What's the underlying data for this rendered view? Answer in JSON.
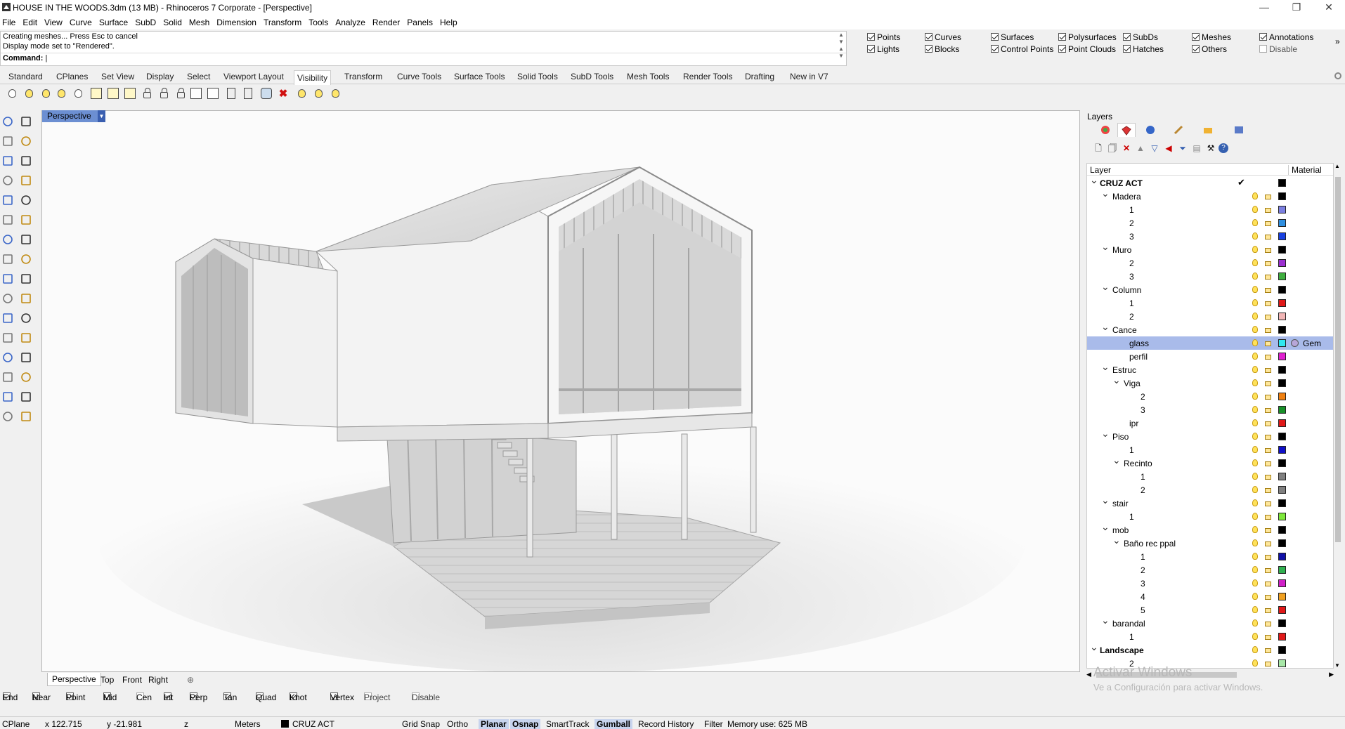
{
  "window": {
    "title": "HOUSE IN THE WOODS.3dm (13 MB) - Rhinoceros 7 Corporate - [Perspective]",
    "minimize": "—",
    "maximize": "❐",
    "close": "✕"
  },
  "menu": [
    "File",
    "Edit",
    "View",
    "Curve",
    "Surface",
    "SubD",
    "Solid",
    "Mesh",
    "Dimension",
    "Transform",
    "Tools",
    "Analyze",
    "Render",
    "Panels",
    "Help"
  ],
  "command": {
    "history1": "Creating meshes... Press Esc to cancel",
    "history2": "Display mode set to \"Rendered\".",
    "prompt": "Command:"
  },
  "selection_filters": {
    "row1": [
      {
        "label": "Points",
        "on": true
      },
      {
        "label": "Curves",
        "on": true
      },
      {
        "label": "Surfaces",
        "on": true
      },
      {
        "label": "Polysurfaces",
        "on": true
      },
      {
        "label": "SubDs",
        "on": true
      },
      {
        "label": "Meshes",
        "on": true
      },
      {
        "label": "Annotations",
        "on": true
      }
    ],
    "row2": [
      {
        "label": "Lights",
        "on": true
      },
      {
        "label": "Blocks",
        "on": true
      },
      {
        "label": "Control Points",
        "on": true
      },
      {
        "label": "Point Clouds",
        "on": true
      },
      {
        "label": "Hatches",
        "on": true
      },
      {
        "label": "Others",
        "on": true
      },
      {
        "label": "Disable",
        "on": false
      }
    ],
    "more": "»"
  },
  "toolbar_tabs": [
    "Standard",
    "CPlanes",
    "Set View",
    "Display",
    "Select",
    "Viewport Layout",
    "Visibility",
    "Transform",
    "Curve Tools",
    "Surface Tools",
    "Solid Tools",
    "SubD Tools",
    "Mesh Tools",
    "Render Tools",
    "Drafting",
    "New in V7"
  ],
  "active_toolbar_tab": "Visibility",
  "viewport": {
    "title": "Perspective",
    "tabs": [
      "Perspective",
      "Top",
      "Front",
      "Right"
    ],
    "add_tab": "⊕"
  },
  "osnaps": [
    {
      "label": "End",
      "on": true
    },
    {
      "label": "Near",
      "on": true
    },
    {
      "label": "Point",
      "on": true
    },
    {
      "label": "Mid",
      "on": true
    },
    {
      "label": "Cen",
      "on": false
    },
    {
      "label": "Int",
      "on": true
    },
    {
      "label": "Perp",
      "on": true
    },
    {
      "label": "Tan",
      "on": true
    },
    {
      "label": "Quad",
      "on": true
    },
    {
      "label": "Knot",
      "on": true
    },
    {
      "label": "Vertex",
      "on": true
    },
    {
      "label": "Project",
      "on": false
    },
    {
      "label": "Disable",
      "on": false
    }
  ],
  "status": {
    "cplane": "CPlane",
    "x": "x 122.715",
    "y": "y -21.981",
    "z": "z",
    "units": "Meters",
    "layer": "CRUZ ACT",
    "grid_snap": "Grid Snap",
    "ortho": "Ortho",
    "planar": "Planar",
    "osnap": "Osnap",
    "smarttrack": "SmartTrack",
    "gumball": "Gumball",
    "record_history": "Record History",
    "filter": "Filter",
    "memory": "Memory use: 625 MB"
  },
  "layers_panel": {
    "title": "Layers",
    "col_layer": "Layer",
    "col_material": "Material",
    "rows": [
      {
        "name": "CRUZ ACT",
        "level": 0,
        "expand": true,
        "current": true,
        "color": "#000000"
      },
      {
        "name": "Madera",
        "level": 1,
        "expand": true,
        "color": "#000000"
      },
      {
        "name": "1",
        "level": 2,
        "color": "#7b7fe0"
      },
      {
        "name": "2",
        "level": 2,
        "color": "#2f8fe0"
      },
      {
        "name": "3",
        "level": 2,
        "color": "#1840e0"
      },
      {
        "name": "Muro",
        "level": 1,
        "expand": true,
        "color": "#000000"
      },
      {
        "name": "2",
        "level": 2,
        "color": "#9b2fd0"
      },
      {
        "name": "3",
        "level": 2,
        "color": "#3fae3f"
      },
      {
        "name": "Column",
        "level": 1,
        "expand": true,
        "color": "#000000"
      },
      {
        "name": "1",
        "level": 2,
        "color": "#e01818"
      },
      {
        "name": "2",
        "level": 2,
        "color": "#f2b6b6"
      },
      {
        "name": "Cance",
        "level": 1,
        "expand": true,
        "color": "#000000"
      },
      {
        "name": "glass",
        "level": 2,
        "color": "#30e8f0",
        "selected": true,
        "material": "Gem"
      },
      {
        "name": "perfil",
        "level": 2,
        "color": "#e020d0"
      },
      {
        "name": "Estruc",
        "level": 1,
        "expand": true,
        "color": "#000000"
      },
      {
        "name": "Viga",
        "level": 2,
        "expand": true,
        "color": "#000000"
      },
      {
        "name": "2",
        "level": 3,
        "color": "#f08010"
      },
      {
        "name": "3",
        "level": 3,
        "color": "#189028"
      },
      {
        "name": "ipr",
        "level": 2,
        "color": "#e01818"
      },
      {
        "name": "Piso",
        "level": 1,
        "expand": true,
        "color": "#000000"
      },
      {
        "name": "1",
        "level": 2,
        "color": "#1010c8"
      },
      {
        "name": "Recinto",
        "level": 2,
        "expand": true,
        "color": "#000000"
      },
      {
        "name": "1",
        "level": 3,
        "color": "#808080"
      },
      {
        "name": "2",
        "level": 3,
        "color": "#808080"
      },
      {
        "name": "stair",
        "level": 1,
        "expand": true,
        "color": "#000000"
      },
      {
        "name": "1",
        "level": 2,
        "color": "#7ee83a"
      },
      {
        "name": "mob",
        "level": 1,
        "expand": true,
        "color": "#000000"
      },
      {
        "name": "Baño rec ppal",
        "level": 2,
        "expand": true,
        "color": "#000000"
      },
      {
        "name": "1",
        "level": 3,
        "color": "#1010a8"
      },
      {
        "name": "2",
        "level": 3,
        "color": "#30b050"
      },
      {
        "name": "3",
        "level": 3,
        "color": "#d020c8"
      },
      {
        "name": "4",
        "level": 3,
        "color": "#f0a020"
      },
      {
        "name": "5",
        "level": 3,
        "color": "#e01818"
      },
      {
        "name": "barandal",
        "level": 1,
        "expand": true,
        "color": "#000000"
      },
      {
        "name": "1",
        "level": 2,
        "color": "#e01818"
      },
      {
        "name": "Landscape",
        "level": 0,
        "expand": true,
        "color": "#000000"
      },
      {
        "name": "2",
        "level": 2,
        "color": "#a8e8a8"
      }
    ]
  },
  "watermark": {
    "line1": "Activar Windows",
    "line2": "Ve a Configuración para activar Windows."
  }
}
